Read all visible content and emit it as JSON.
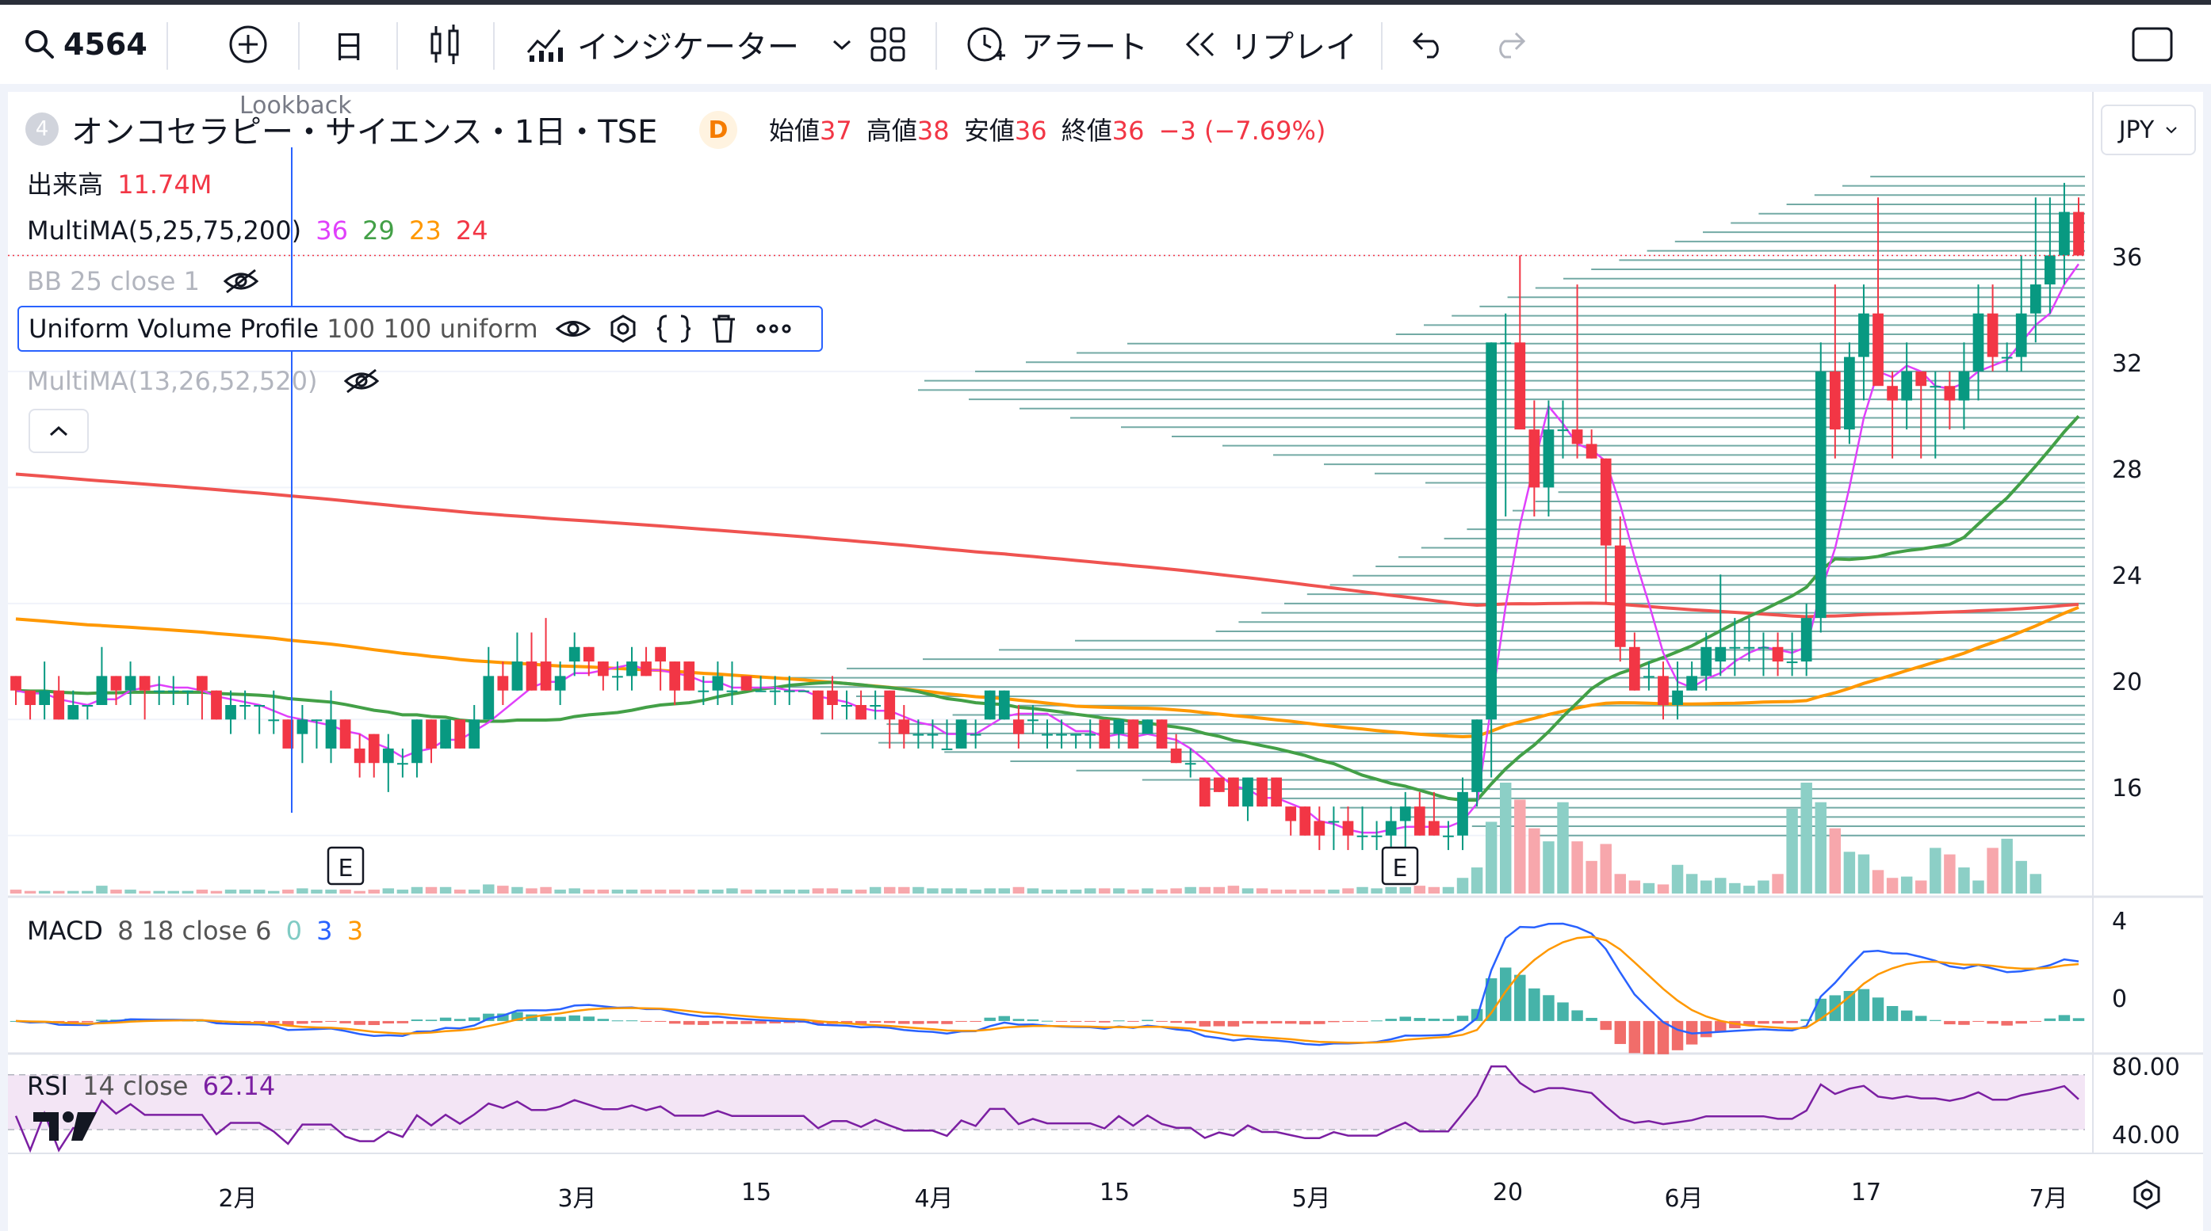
{
  "toolbar": {
    "symbol": "4564",
    "interval": "日",
    "indicators_label": "インジケーター",
    "alert_label": "アラート",
    "replay_label": "リプレイ"
  },
  "legend": {
    "symbol_icon_text": "4",
    "title": "オンコセラピー・サイエンス・1日・TSE",
    "delay_badge": "D",
    "open_label": "始値",
    "open_value": "37",
    "high_label": "高値",
    "high_value": "38",
    "low_label": "安値",
    "low_value": "36",
    "close_label": "終値",
    "close_value": "36",
    "change": "−3 (−7.69%)",
    "lookback": "Lookback",
    "volume_label": "出来高",
    "volume_value": "11.74M",
    "multima_label": "MultiMA(5,25,75,200)",
    "multima_values": [
      "36",
      "29",
      "23",
      "24"
    ],
    "bb_label": "BB 25 close 1",
    "uvp_label": "Uniform Volume Profile",
    "uvp_params": "100 100 uniform",
    "multima2_label": "MultiMA(13,26,52,520)",
    "macd_label": "MACD",
    "macd_params": "8 18 close 6",
    "macd_values": [
      "0",
      "3",
      "3"
    ],
    "rsi_label": "RSI",
    "rsi_params": "14 close",
    "rsi_value": "62.14",
    "currency": "JPY"
  },
  "colors": {
    "up": "#089981",
    "down": "#f23645",
    "ma5": "#e91e63",
    "ma25": "#43a047",
    "ma75": "#ff9800",
    "ma200": "#ef5350",
    "macd": "#2962ff",
    "signal": "#ff9800",
    "rsi": "#7b1fa2",
    "vp": "#5b9c96"
  },
  "axes": {
    "price_ticks": [
      "36",
      "32",
      "28",
      "24",
      "20",
      "16"
    ],
    "macd_ticks": [
      "4",
      "0"
    ],
    "rsi_ticks": [
      "80.00",
      "40.00"
    ],
    "x_labels": [
      "2月",
      "3月",
      "15",
      "4月",
      "15",
      "5月",
      "20",
      "6月",
      "17",
      "7月"
    ],
    "earnings_marker": "E"
  },
  "chart_data": {
    "type": "candlestick",
    "candles": [
      [
        21.5,
        21.5,
        20.5,
        21
      ],
      [
        21,
        21,
        20,
        20.5
      ],
      [
        20.5,
        22,
        20,
        21
      ],
      [
        21,
        21.5,
        20,
        20
      ],
      [
        20,
        21,
        20,
        20.5
      ],
      [
        20.5,
        20.5,
        20,
        20.5
      ],
      [
        20.5,
        22.5,
        20.5,
        21.5
      ],
      [
        21.5,
        21.5,
        20.5,
        21
      ],
      [
        21,
        22,
        20.5,
        21.5
      ],
      [
        21.5,
        21.5,
        20,
        21
      ],
      [
        21,
        21.5,
        20.5,
        21
      ],
      [
        21,
        21.5,
        20.5,
        21
      ],
      [
        21,
        21,
        20.5,
        21
      ],
      [
        21.5,
        21.5,
        20,
        21
      ],
      [
        21,
        21,
        20,
        20
      ],
      [
        20,
        21,
        19.5,
        20.5
      ],
      [
        20.5,
        21,
        20,
        20.5
      ],
      [
        20.5,
        20.5,
        19.5,
        20.5
      ],
      [
        20,
        21,
        19.5,
        20
      ],
      [
        20,
        20,
        19.5,
        19
      ],
      [
        19.5,
        20.5,
        18.5,
        20
      ],
      [
        20,
        20,
        19,
        20
      ],
      [
        19,
        21,
        18.5,
        20
      ],
      [
        20,
        20,
        19,
        19
      ],
      [
        19,
        19.5,
        18,
        18.5
      ],
      [
        19.5,
        19.5,
        18,
        18.5
      ],
      [
        18.5,
        19.5,
        17.5,
        19
      ],
      [
        18.5,
        19,
        18,
        18.5
      ],
      [
        18.5,
        20,
        18,
        20
      ],
      [
        20,
        20,
        18.5,
        19
      ],
      [
        19,
        20,
        19,
        20
      ],
      [
        20,
        20,
        19,
        19
      ],
      [
        19,
        20.5,
        19,
        20
      ],
      [
        20,
        22.5,
        20,
        21.5
      ],
      [
        21.5,
        22,
        20.5,
        21
      ],
      [
        21,
        23,
        21,
        22
      ],
      [
        22,
        23,
        21,
        21
      ],
      [
        22,
        23.5,
        21,
        21
      ],
      [
        21,
        22,
        20.5,
        21.5
      ],
      [
        22,
        23,
        21.5,
        22.5
      ],
      [
        22.5,
        22.5,
        21.5,
        22
      ],
      [
        22,
        22,
        21,
        21.5
      ],
      [
        21.5,
        22,
        21,
        21.5
      ],
      [
        21.5,
        22.5,
        21,
        22
      ],
      [
        22,
        22.5,
        21.5,
        21.5
      ],
      [
        22.5,
        22.5,
        21,
        22
      ],
      [
        22,
        22,
        20.5,
        21
      ],
      [
        22,
        22,
        21,
        21
      ],
      [
        21,
        21.5,
        20.5,
        21
      ],
      [
        21,
        22,
        20.5,
        21.5
      ],
      [
        21,
        22,
        20.5,
        21
      ],
      [
        21.5,
        21.5,
        21,
        21
      ],
      [
        21,
        21.5,
        21,
        21
      ],
      [
        21,
        21.5,
        20.5,
        21
      ],
      [
        21,
        21.5,
        20.5,
        21
      ],
      [
        21,
        21,
        21,
        21
      ],
      [
        21,
        21,
        20,
        20
      ],
      [
        21,
        21.5,
        20,
        20.5
      ],
      [
        20.5,
        21,
        20,
        20.5
      ],
      [
        20.5,
        21,
        20,
        20
      ],
      [
        20.5,
        21,
        20,
        20.5
      ],
      [
        21,
        21,
        19,
        20
      ],
      [
        20,
        20.5,
        19,
        19.5
      ],
      [
        19.5,
        20,
        19,
        19.5
      ],
      [
        19.5,
        20,
        19,
        19.5
      ],
      [
        19,
        20,
        19,
        19
      ],
      [
        19,
        20,
        19,
        20
      ],
      [
        19.5,
        20,
        19,
        19.5
      ],
      [
        20,
        21,
        20,
        21
      ],
      [
        20,
        21,
        20,
        21
      ],
      [
        20,
        20.5,
        19,
        19.5
      ],
      [
        20,
        20.5,
        19.5,
        20
      ],
      [
        19.5,
        20,
        19,
        19.5
      ],
      [
        19.5,
        20,
        19,
        19.5
      ],
      [
        19.5,
        19.5,
        19,
        19.5
      ],
      [
        19.5,
        20,
        19,
        19.5
      ],
      [
        20,
        20,
        19,
        19
      ],
      [
        19.5,
        20,
        19,
        20
      ],
      [
        20,
        20,
        19,
        19
      ],
      [
        19.5,
        20,
        19.5,
        20
      ],
      [
        20,
        20,
        19,
        19
      ],
      [
        19,
        19.5,
        18.5,
        18.5
      ],
      [
        18.5,
        19,
        18,
        18.5
      ],
      [
        18,
        18,
        17,
        17
      ],
      [
        18,
        18,
        17.5,
        17.5
      ],
      [
        18,
        18,
        17,
        17
      ],
      [
        17,
        18,
        16.5,
        18
      ],
      [
        18,
        18,
        17,
        17
      ],
      [
        18,
        18,
        17,
        17
      ],
      [
        17,
        17,
        16,
        16.5
      ],
      [
        17,
        17,
        16,
        16
      ],
      [
        16.5,
        17,
        15.5,
        16
      ],
      [
        16.5,
        17,
        15.5,
        16.5
      ],
      [
        16.5,
        17,
        15.5,
        16
      ],
      [
        16,
        17,
        15.5,
        16
      ],
      [
        16,
        16.5,
        15.5,
        16
      ],
      [
        16,
        17,
        15.5,
        16.5
      ],
      [
        16.5,
        17.5,
        15.5,
        17
      ],
      [
        17,
        17.5,
        16,
        16
      ],
      [
        16.5,
        17.5,
        16,
        16
      ],
      [
        16,
        16.5,
        15.5,
        16
      ],
      [
        16,
        18,
        15.5,
        17.5
      ],
      [
        17.5,
        20,
        17,
        20
      ],
      [
        20,
        33,
        18,
        33
      ],
      [
        33,
        34,
        27,
        33
      ],
      [
        33,
        36,
        31,
        30
      ],
      [
        30,
        31,
        27,
        28
      ],
      [
        28,
        31,
        27,
        30
      ],
      [
        30,
        31,
        29,
        30
      ],
      [
        30,
        35,
        29,
        29.5
      ],
      [
        29.5,
        30,
        29,
        29
      ],
      [
        29,
        29,
        24,
        26
      ],
      [
        26,
        27,
        22,
        22.5
      ],
      [
        22.5,
        23,
        21,
        21
      ],
      [
        21.5,
        22,
        21,
        21.5
      ],
      [
        21.5,
        22,
        20,
        20.5
      ],
      [
        20.5,
        22,
        20,
        21
      ],
      [
        21,
        22,
        21,
        21.5
      ],
      [
        21.5,
        23,
        21,
        22.5
      ],
      [
        22,
        25,
        21.5,
        22.5
      ],
      [
        22.5,
        23.5,
        21.5,
        22.5
      ],
      [
        22.5,
        23.5,
        22,
        22.5
      ],
      [
        22.5,
        23,
        21.5,
        22.5
      ],
      [
        22.5,
        23,
        21.5,
        22
      ],
      [
        22,
        23,
        21.5,
        22
      ],
      [
        22,
        24,
        21.5,
        23.5
      ],
      [
        23.5,
        33,
        23,
        32
      ],
      [
        32,
        35,
        29,
        30
      ],
      [
        30,
        33,
        29.5,
        32.5
      ],
      [
        32.5,
        35,
        31,
        34
      ],
      [
        34,
        38,
        32,
        31.5
      ],
      [
        31.5,
        32,
        29,
        31
      ],
      [
        31,
        33,
        30,
        32
      ],
      [
        32,
        32,
        29,
        31.5
      ],
      [
        31.5,
        32,
        29,
        31.5
      ],
      [
        31.5,
        32,
        30,
        31
      ],
      [
        31,
        33,
        30,
        32
      ],
      [
        32,
        35,
        31,
        34
      ],
      [
        34,
        35,
        32,
        32.5
      ],
      [
        32.5,
        33,
        32,
        32.5
      ],
      [
        32.5,
        36,
        32,
        34
      ],
      [
        34,
        38,
        33,
        35
      ],
      [
        35,
        38,
        34,
        36
      ],
      [
        36,
        38.5,
        35,
        37.5
      ],
      [
        37.5,
        38,
        36,
        36
      ]
    ],
    "volume": [
      0.3,
      0.2,
      0.2,
      0.2,
      0.2,
      0.2,
      0.6,
      0.3,
      0.3,
      0.2,
      0.2,
      0.2,
      0.2,
      0.3,
      0.2,
      0.3,
      0.3,
      0.3,
      0.2,
      0.3,
      0.4,
      0.3,
      0.3,
      0.3,
      0.2,
      0.3,
      0.4,
      0.3,
      0.5,
      0.5,
      0.5,
      0.3,
      0.3,
      0.7,
      0.6,
      0.5,
      0.4,
      0.5,
      0.3,
      0.4,
      0.3,
      0.3,
      0.3,
      0.3,
      0.3,
      0.3,
      0.3,
      0.3,
      0.3,
      0.3,
      0.4,
      0.3,
      0.3,
      0.3,
      0.3,
      0.3,
      0.4,
      0.4,
      0.3,
      0.3,
      0.5,
      0.5,
      0.5,
      0.5,
      0.4,
      0.4,
      0.4,
      0.3,
      0.4,
      0.4,
      0.5,
      0.4,
      0.3,
      0.3,
      0.3,
      0.4,
      0.4,
      0.4,
      0.3,
      0.4,
      0.3,
      0.4,
      0.5,
      0.5,
      0.5,
      0.6,
      0.4,
      0.4,
      0.3,
      0.3,
      0.3,
      0.3,
      0.3,
      0.4,
      0.5,
      0.4,
      0.5,
      0.5,
      0.6,
      0.5,
      0.5,
      1.2,
      2.0,
      5.5,
      8.5,
      7.2,
      5.0,
      4.0,
      7.0,
      4.0,
      2.5,
      3.8,
      1.5,
      1.0,
      0.8,
      0.7,
      2.2,
      1.5,
      1.0,
      1.2,
      0.8,
      0.6,
      1.0,
      1.5,
      6.5,
      8.5,
      7.0,
      5.0,
      3.2,
      3.0,
      1.8,
      1.2,
      1.3,
      1.0,
      3.5,
      3.0,
      2.0,
      1.0,
      3.5,
      4.2,
      2.5,
      1.5
    ],
    "ylim": [
      14,
      40
    ],
    "vp_note": "",
    "macd_ylim": [
      -1,
      4.5
    ],
    "rsi_ylim": [
      25,
      92
    ],
    "rsi_last": 62.14
  }
}
